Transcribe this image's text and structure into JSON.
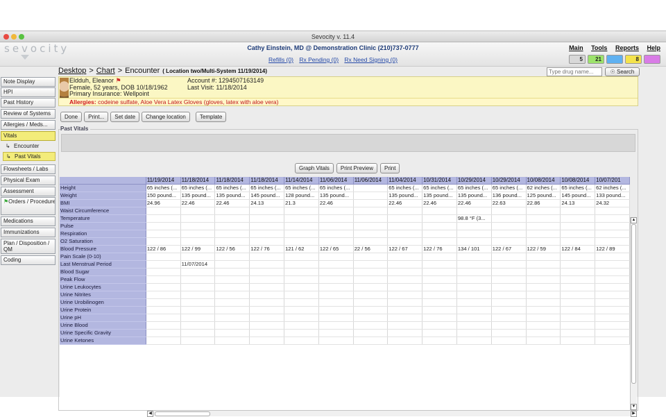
{
  "window": {
    "title": "Sevocity v. 11.4",
    "traffic_colors": [
      "#e84a42",
      "#f1b83a",
      "#58c241"
    ]
  },
  "header": {
    "logo": "sevocity",
    "provider": "Cathy Einstein, MD @ Demonstration Clinic (210)737-0777",
    "rx_links": [
      "Refills (0)",
      "Rx Pending (0)",
      "Rx Need Signing (0)"
    ],
    "menu": [
      "Main",
      "Tools",
      "Reports",
      "Help"
    ],
    "badges": [
      {
        "count": "5",
        "color": "#d8d8d8",
        "icon": "inbox-icon"
      },
      {
        "count": "21",
        "color": "#9de36b",
        "icon": "task-icon"
      },
      {
        "count": "",
        "color": "#5fb1f1",
        "icon": "message-icon"
      },
      {
        "count": "8",
        "color": "#f4e34c",
        "icon": "alert-icon"
      },
      {
        "count": "",
        "color": "#d97ce6",
        "icon": "mail-icon"
      }
    ]
  },
  "breadcrumb": {
    "items": [
      "Desktop",
      "Chart"
    ],
    "current": "Encounter",
    "separator": ">",
    "location": "( Location two/Multi-System 11/19/2014)"
  },
  "drug_search": {
    "placeholder": "Type drug name...",
    "button": "Search"
  },
  "sidebar": {
    "items": [
      {
        "label": "Note Display",
        "top": 0
      },
      {
        "label": "HPI",
        "top": 0
      },
      {
        "label": "Past History",
        "top": 0
      },
      {
        "label": "Review of Systems",
        "top": 0
      },
      {
        "label": "Allergies / Meds...",
        "top": 0
      },
      {
        "label": "Vitals",
        "top": 0
      }
    ],
    "vitals_sub": [
      "Encounter",
      "Past Vitals"
    ],
    "items2": [
      "Flowsheets / Labs",
      "Physical Exam",
      "Assessment",
      "Orders / Procedure",
      "Medications",
      "Immunizations",
      "Plan / Disposition / QM",
      "Coding"
    ]
  },
  "patient": {
    "name": "Eldduh, Eleanor",
    "demographics": "Female, 52 years, DOB 10/18/1962",
    "insurance": "Primary Insurance: Wellpoint",
    "account": "Account #: 1294507163149",
    "last_visit": "Last Visit: 11/18/2014",
    "allergies_label": "Allergies:",
    "allergies": "codeine sulfate, Aloe Vera Latex Gloves (gloves, latex with aloe vera)"
  },
  "toolbar": {
    "done": "Done",
    "print": "Print...",
    "set_date": "Set date",
    "change_location": "Change location",
    "template": "Template"
  },
  "past_vitals": {
    "legend": "Past Vitals",
    "graph": "Graph Vitals",
    "preview": "Print Preview",
    "print": "Print",
    "dates": [
      "11/19/2014",
      "11/18/2014",
      "11/18/2014",
      "11/18/2014",
      "11/14/2014",
      "11/06/2014",
      "11/06/2014",
      "11/04/2014",
      "10/31/2014",
      "10/29/2014",
      "10/29/2014",
      "10/08/2014",
      "10/08/2014",
      "10/07/201"
    ],
    "rows": [
      {
        "label": "Height",
        "values": [
          "65 inches (...",
          "65 inches (...",
          "65 inches (...",
          "65 inches (...",
          "65 inches (...",
          "65 inches (...",
          "",
          "65 inches (...",
          "65 inches (...",
          "65 inches (...",
          "65 inches (...",
          "62 inches (...",
          "65 inches (...",
          "62 inches (..."
        ]
      },
      {
        "label": "Weight",
        "values": [
          "150 pound...",
          "135 pound...",
          "135 pound...",
          "145 pound...",
          "128 pound...",
          "135 pound...",
          "",
          "135 pound...",
          "135 pound...",
          "135 pound...",
          "136 pound...",
          "125 pound...",
          "145 pound...",
          "133 pound..."
        ]
      },
      {
        "label": "BMI",
        "values": [
          "24.96",
          "22.46",
          "22.46",
          "24.13",
          "21.3",
          "22.46",
          "",
          "22.46",
          "22.46",
          "22.46",
          "22.63",
          "22.86",
          "24.13",
          "24.32"
        ]
      },
      {
        "label": "Waist Circumference",
        "values": []
      },
      {
        "label": "Temperature",
        "values": [
          "",
          "",
          "",
          "",
          "",
          "",
          "",
          "",
          "",
          "98.8 °F (3...",
          "",
          "",
          "",
          ""
        ]
      },
      {
        "label": "Pulse",
        "values": []
      },
      {
        "label": "Respiration",
        "values": []
      },
      {
        "label": "O2 Saturation",
        "values": []
      },
      {
        "label": "Blood Pressure",
        "values": [
          "122 / 86",
          "122 / 99",
          "122 / 56",
          "122 / 76",
          "121 / 62",
          "122 / 65",
          "22 / 56",
          "122 / 67",
          "122 / 76",
          "134 / 101",
          "122 / 67",
          "122 / 59",
          "122 / 84",
          "122 / 89"
        ]
      },
      {
        "label": "Pain Scale (0-10)",
        "values": []
      },
      {
        "label": "Last Menstrual Period",
        "values": [
          "",
          "11/07/2014"
        ]
      },
      {
        "label": "Blood Sugar",
        "values": []
      },
      {
        "label": "Peak Flow",
        "values": []
      },
      {
        "label": "Urine Leukocytes",
        "values": []
      },
      {
        "label": "Urine Nitrites",
        "values": []
      },
      {
        "label": "Urine Urobilinogen",
        "values": []
      },
      {
        "label": "Urine Protein",
        "values": []
      },
      {
        "label": "Urine pH",
        "values": []
      },
      {
        "label": "Urine Blood",
        "values": []
      },
      {
        "label": "Urine Specific Gravity",
        "values": []
      },
      {
        "label": "Urine Ketones",
        "values": []
      }
    ]
  }
}
